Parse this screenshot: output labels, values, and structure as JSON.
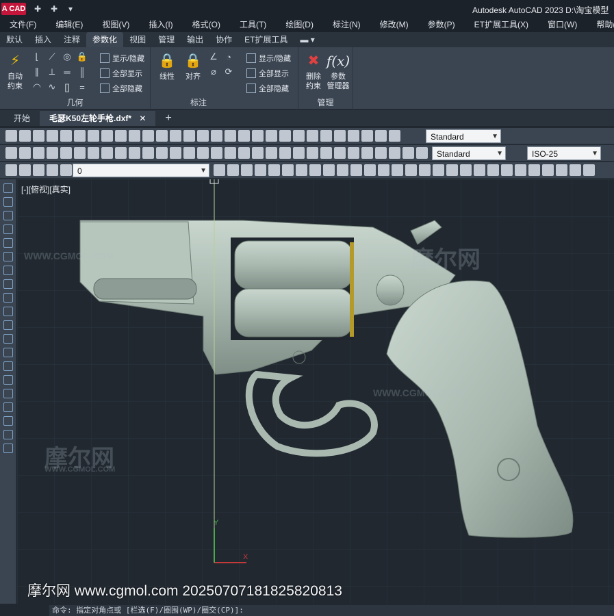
{
  "titlebar": {
    "logo": "A CAD",
    "title": "Autodesk AutoCAD 2023    D:\\淘宝模型"
  },
  "menubar": [
    "文件(F)",
    "编辑(E)",
    "视图(V)",
    "插入(I)",
    "格式(O)",
    "工具(T)",
    "绘图(D)",
    "标注(N)",
    "修改(M)",
    "参数(P)",
    "ET扩展工具(X)",
    "窗口(W)",
    "帮助(H)"
  ],
  "ribbon_tabs": [
    "默认",
    "插入",
    "注释",
    "参数化",
    "视图",
    "管理",
    "输出",
    "协作",
    "ET扩展工具"
  ],
  "ribbon_active_tab": "参数化",
  "ribbon": {
    "geometry": {
      "title": "几何",
      "auto_constrain": "自动\n约束",
      "show_hide": "显示/隐藏",
      "show_all": "全部显示",
      "hide_all": "全部隐藏"
    },
    "dimension": {
      "title": "标注",
      "linear": "线性",
      "aligned": "对齐",
      "show_hide": "显示/隐藏",
      "show_all": "全部显示",
      "hide_all": "全部隐藏"
    },
    "manage": {
      "title": "管理",
      "delete_constraints": "删除\n约束",
      "param_manager": "参数\n管理器"
    }
  },
  "doc_tabs": [
    "开始",
    "毛瑟K50左轮手枪.dxf*"
  ],
  "toolbar": {
    "text_style": "Standard",
    "table_style": "Standard",
    "dim_style": "ISO-25",
    "layer": "0",
    "visual_style": "Standard"
  },
  "viewport": {
    "label": "[-][俯视][真实]",
    "watermarks": [
      "摩尔网",
      "WWW.CGMOL.COM"
    ]
  },
  "footer_watermark": "摩尔网 www.cgmol.com 20250707181825820813",
  "command_line": "命令: 指定对角点或 [栏选(F)/圈围(WP)/圈交(CP)]:",
  "colors": {
    "background": "#212830",
    "ribbon": "#3b4552",
    "model": "#a9b9b0",
    "logo": "#c4163b"
  }
}
